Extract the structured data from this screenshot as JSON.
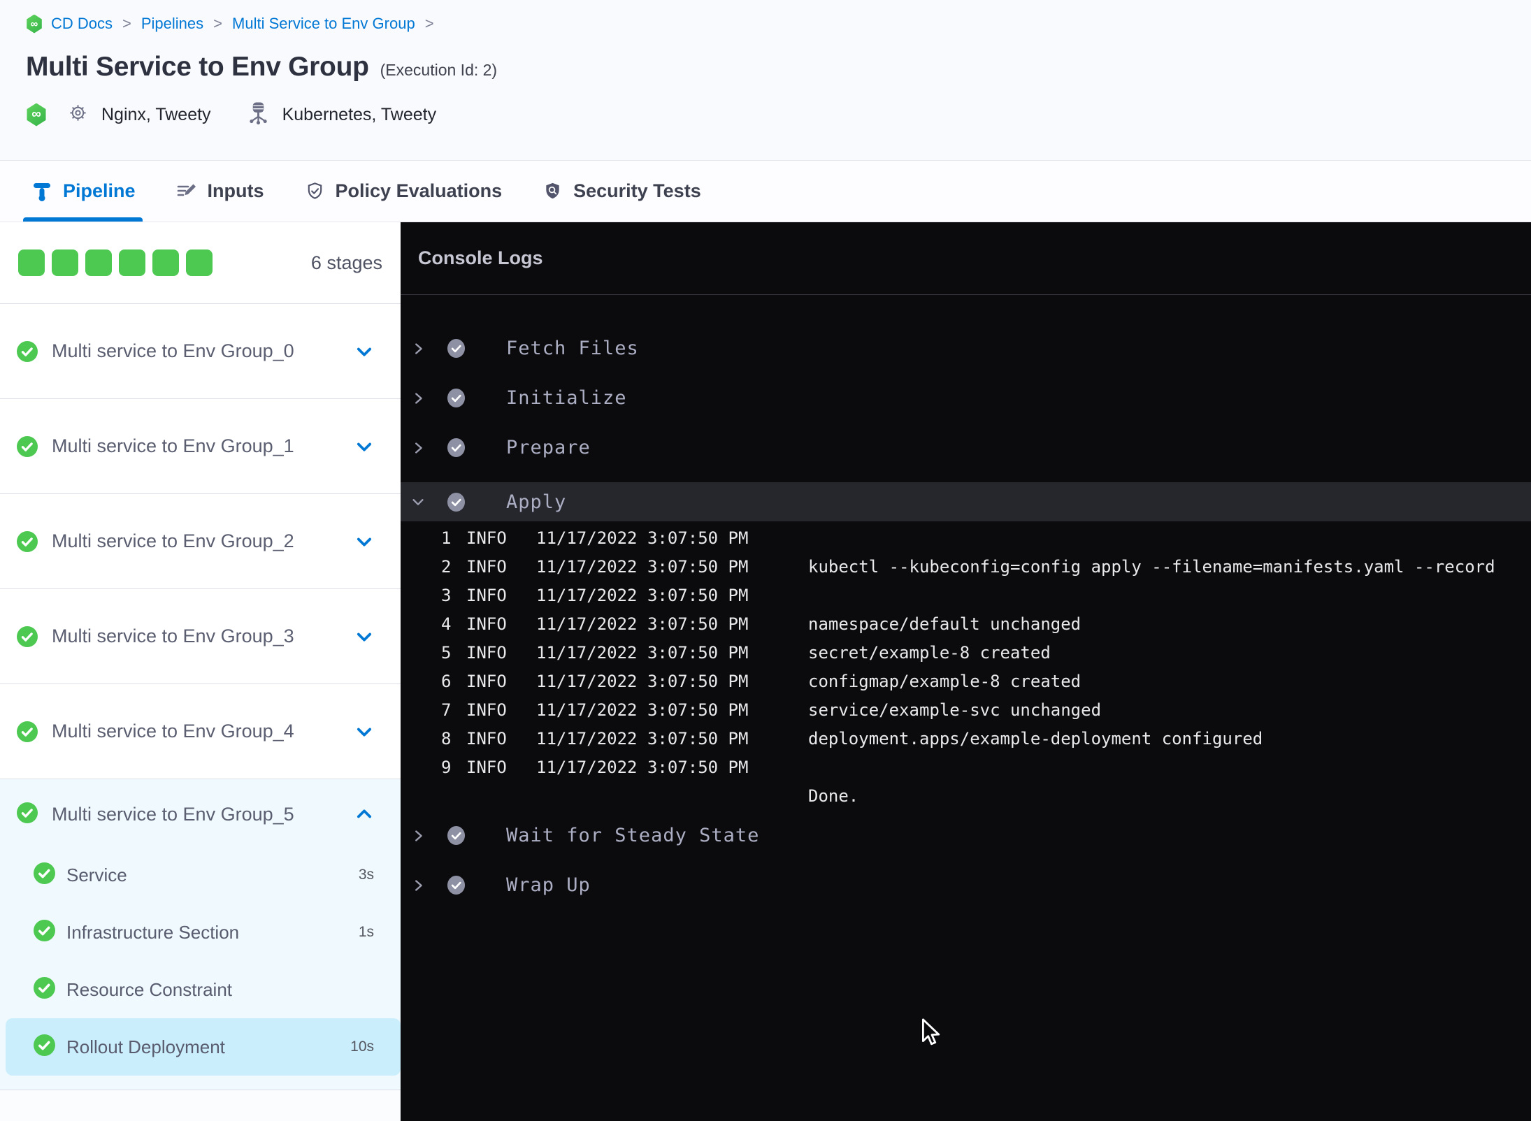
{
  "colors": {
    "accent_blue": "#0278D5",
    "success_green": "#4DC952",
    "console_bg": "#0B0B0E",
    "expanded_stage_bg": "#EFF9FE",
    "selected_step_bg": "#CBEEFD"
  },
  "breadcrumb": {
    "items": [
      "CD Docs",
      "Pipelines",
      "Multi Service to Env Group"
    ],
    "separator": ">"
  },
  "header": {
    "title": "Multi Service to Env Group",
    "execution_id": "(Execution Id: 2)",
    "service": "Nginx, Tweety",
    "infrastructure": "Kubernetes, Tweety"
  },
  "tabs": [
    {
      "label": "Pipeline",
      "icon": "pipeline-icon",
      "active": true
    },
    {
      "label": "Inputs",
      "icon": "inputs-icon",
      "active": false
    },
    {
      "label": "Policy Evaluations",
      "icon": "policy-shield-icon",
      "active": false
    },
    {
      "label": "Security Tests",
      "icon": "security-shield-icon",
      "active": false
    }
  ],
  "sidebar": {
    "stage_count_label": "6 stages",
    "progress_squares": [
      {
        "status": "success"
      },
      {
        "status": "success"
      },
      {
        "status": "success"
      },
      {
        "status": "success"
      },
      {
        "status": "success"
      },
      {
        "status": "success"
      }
    ],
    "collapsed_stages": [
      {
        "label": "Multi service to Env Group_0"
      },
      {
        "label": "Multi service to Env Group_1"
      },
      {
        "label": "Multi service to Env Group_2"
      },
      {
        "label": "Multi service to Env Group_3"
      },
      {
        "label": "Multi service to Env Group_4"
      }
    ],
    "expanded_stage": {
      "label": "Multi service to Env Group_5",
      "steps": [
        {
          "label": "Service",
          "duration": "3s",
          "selected": false
        },
        {
          "label": "Infrastructure Section",
          "duration": "1s",
          "selected": false
        },
        {
          "label": "Resource Constraint",
          "duration": "",
          "selected": false
        },
        {
          "label": "Rollout Deployment",
          "duration": "10s",
          "selected": true
        }
      ]
    }
  },
  "console": {
    "title": "Console Logs",
    "collapsed_steps_before": [
      {
        "label": "Fetch Files"
      },
      {
        "label": "Initialize"
      },
      {
        "label": "Prepare"
      }
    ],
    "expanded_step": {
      "label": "Apply"
    },
    "logs": [
      {
        "num": "1",
        "level": "INFO",
        "time": "11/17/2022 3:07:50 PM",
        "msg": ""
      },
      {
        "num": "2",
        "level": "INFO",
        "time": "11/17/2022 3:07:50 PM",
        "msg": "kubectl --kubeconfig=config apply --filename=manifests.yaml --record"
      },
      {
        "num": "3",
        "level": "INFO",
        "time": "11/17/2022 3:07:50 PM",
        "msg": ""
      },
      {
        "num": "4",
        "level": "INFO",
        "time": "11/17/2022 3:07:50 PM",
        "msg": "namespace/default unchanged"
      },
      {
        "num": "5",
        "level": "INFO",
        "time": "11/17/2022 3:07:50 PM",
        "msg": "secret/example-8 created"
      },
      {
        "num": "6",
        "level": "INFO",
        "time": "11/17/2022 3:07:50 PM",
        "msg": "configmap/example-8 created"
      },
      {
        "num": "7",
        "level": "INFO",
        "time": "11/17/2022 3:07:50 PM",
        "msg": "service/example-svc unchanged"
      },
      {
        "num": "8",
        "level": "INFO",
        "time": "11/17/2022 3:07:50 PM",
        "msg": "deployment.apps/example-deployment configured"
      },
      {
        "num": "9",
        "level": "INFO",
        "time": "11/17/2022 3:07:50 PM",
        "msg": ""
      },
      {
        "num": "",
        "level": "",
        "time": "",
        "msg": "Done."
      }
    ],
    "collapsed_steps_after": [
      {
        "label": "Wait for Steady State"
      },
      {
        "label": "Wrap Up"
      }
    ]
  }
}
